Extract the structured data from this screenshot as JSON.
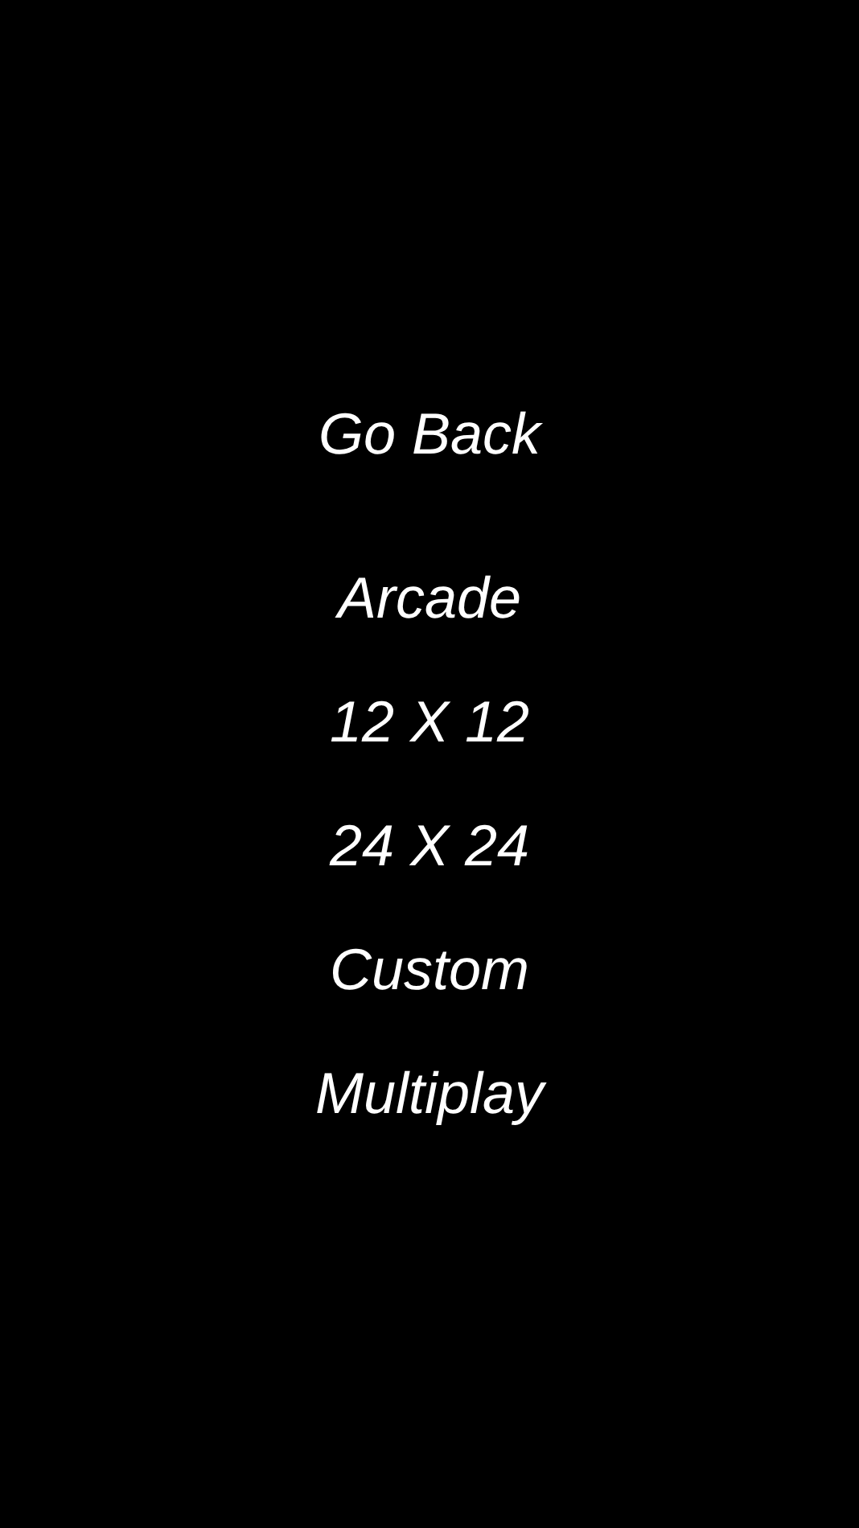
{
  "back_button": {
    "label": "Go Back"
  },
  "menu_items": [
    {
      "label": "Arcade"
    },
    {
      "label": "12 X 12"
    },
    {
      "label": "24 X 24"
    },
    {
      "label": "Custom"
    },
    {
      "label": "Multiplay"
    }
  ]
}
